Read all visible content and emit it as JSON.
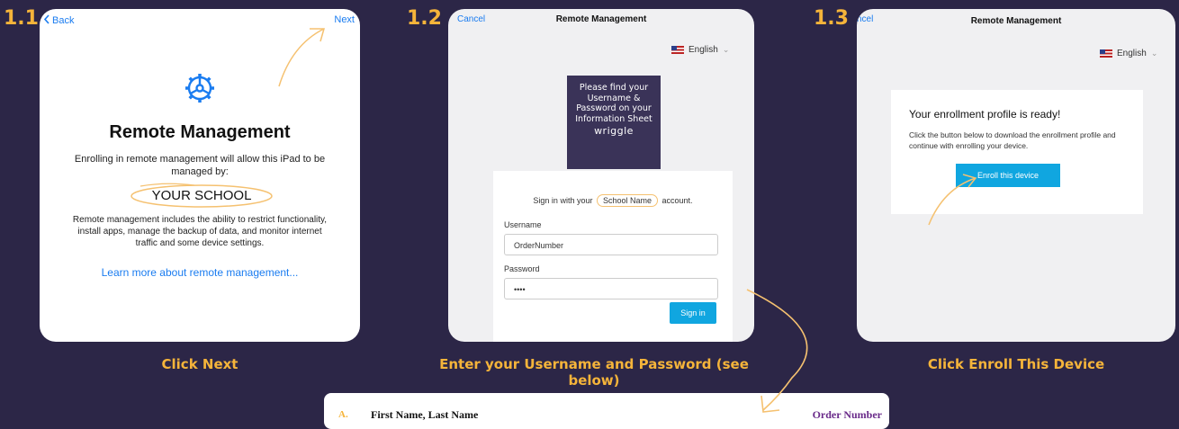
{
  "steps": [
    {
      "number": "1.1",
      "caption": "Click Next"
    },
    {
      "number": "1.2",
      "caption": "Enter your Username and Password (see below)"
    },
    {
      "number": "1.3",
      "caption": "Click Enroll This Device"
    }
  ],
  "panel1": {
    "back_label": "Back",
    "next_label": "Next",
    "title": "Remote Management",
    "description": "Enrolling in remote management will allow this iPad to be managed by:",
    "school": "YOUR SCHOOL",
    "description2": "Remote management includes the ability to restrict functionality, install apps, manage the backup of data, and monitor internet traffic and some device settings.",
    "learn_more": "Learn more about remote management..."
  },
  "panel2": {
    "cancel_label": "Cancel",
    "header": "Remote Management",
    "language": "English",
    "info_text": "Please find your Username & Password on your Information Sheet",
    "info_brand": "wriggle",
    "signin_prefix": "Sign in with your",
    "school_name": "School Name",
    "signin_suffix": "account.",
    "username_label": "Username",
    "username_value": "OrderNumber",
    "password_label": "Password",
    "password_value": "••••",
    "signin_button": "Sign in"
  },
  "panel3": {
    "cancel_label": "ncel",
    "header": "Remote Management",
    "language": "English",
    "ready_title": "Your enrollment profile is ready!",
    "description": "Click the button below to download the enrollment profile and continue with enrolling your device.",
    "enroll_button": "Enroll this device"
  },
  "table_row": {
    "letter": "A.",
    "name": "First Name, Last Name",
    "order": "Order Number"
  },
  "colors": {
    "background": "#2c2647",
    "accent": "#f5b43a",
    "link": "#1a7cf0",
    "button": "#10a6e0"
  }
}
